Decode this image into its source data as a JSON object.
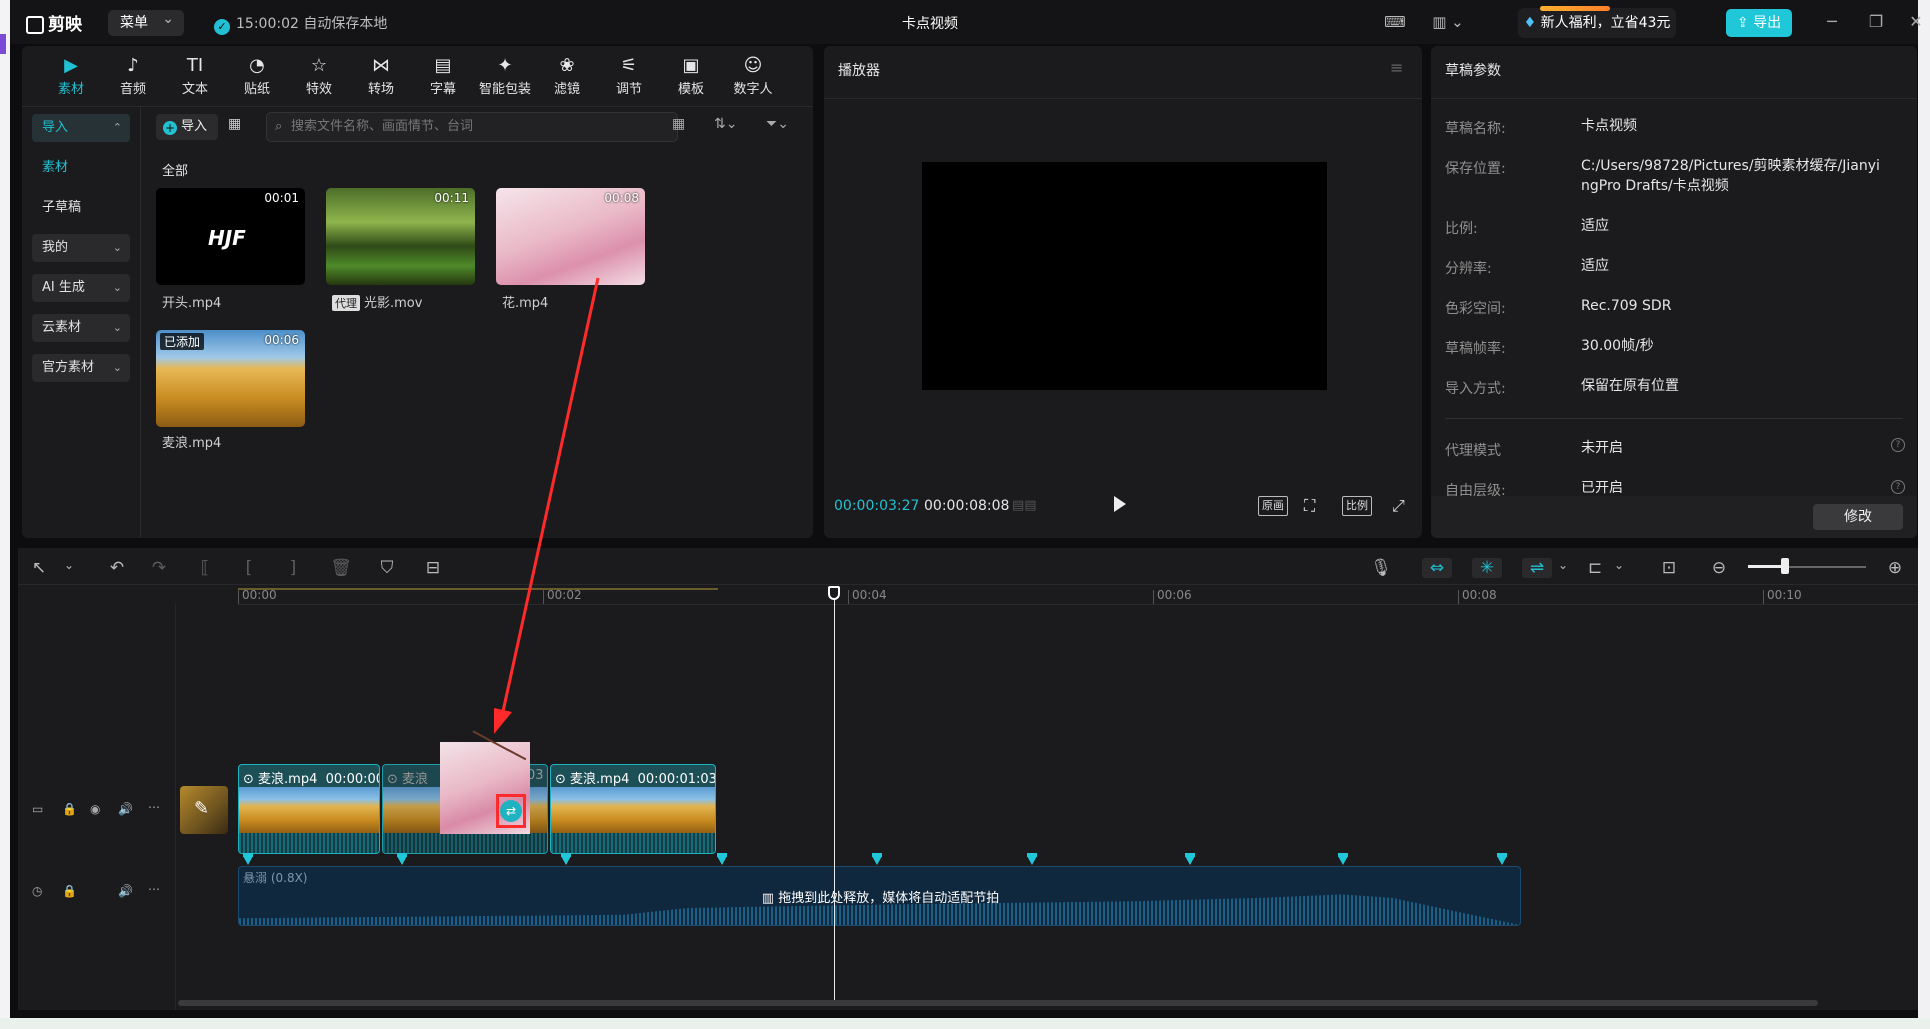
{
  "app": {
    "logo": "剪映",
    "menu_label": "菜单",
    "save_status": "15:00:02 自动保存本地",
    "title": "卡点视频",
    "promo": "新人福利，立省43元",
    "export_label": "导出"
  },
  "media_tabs": [
    {
      "label": "素材",
      "icon": "play-box-icon",
      "glyph": "▶"
    },
    {
      "label": "音频",
      "icon": "music-disc-icon",
      "glyph": "♪"
    },
    {
      "label": "文本",
      "icon": "text-icon",
      "glyph": "TI"
    },
    {
      "label": "贴纸",
      "icon": "sticker-icon",
      "glyph": "◔"
    },
    {
      "label": "特效",
      "icon": "effects-star-icon",
      "glyph": "☆"
    },
    {
      "label": "转场",
      "icon": "transition-icon",
      "glyph": "⋈"
    },
    {
      "label": "字幕",
      "icon": "subtitle-icon",
      "glyph": "▤"
    },
    {
      "label": "智能包装",
      "icon": "smart-pack-icon",
      "glyph": "✦"
    },
    {
      "label": "滤镜",
      "icon": "filter-icon",
      "glyph": "❀"
    },
    {
      "label": "调节",
      "icon": "adjust-icon",
      "glyph": "⚟"
    },
    {
      "label": "模板",
      "icon": "template-icon",
      "glyph": "▣"
    },
    {
      "label": "数字人",
      "icon": "digital-human-icon",
      "glyph": "☺"
    }
  ],
  "side_nav": {
    "import": "导入",
    "material": "素材",
    "sub_draft": "子草稿",
    "mine": "我的",
    "ai_gen": "AI 生成",
    "cloud": "云素材",
    "official": "官方素材"
  },
  "media": {
    "import_btn": "导入",
    "search_placeholder": "搜索文件名称、画面情节、台词",
    "section": "全部",
    "items": [
      {
        "name": "开头.mp4",
        "duration": "00:01",
        "overlay": "HJF"
      },
      {
        "name": "光影.mov",
        "duration": "00:11",
        "tag": "代理"
      },
      {
        "name": "花.mp4",
        "duration": "00:08"
      },
      {
        "name": "麦浪.mp4",
        "duration": "00:06",
        "badge": "已添加"
      }
    ]
  },
  "player": {
    "title": "播放器",
    "current": "00:00:03:27",
    "total": "00:00:08:08",
    "btn_original": "原画",
    "btn_ratio": "比例"
  },
  "params": {
    "title": "草稿参数",
    "rows": [
      {
        "k": "草稿名称:",
        "v": "卡点视频"
      },
      {
        "k": "保存位置:",
        "v": "C:/Users/98728/Pictures/剪映素材缓存/JianyingPro Drafts/卡点视频"
      },
      {
        "k": "比例:",
        "v": "适应"
      },
      {
        "k": "分辨率:",
        "v": "适应"
      },
      {
        "k": "色彩空间:",
        "v": "Rec.709 SDR"
      },
      {
        "k": "草稿帧率:",
        "v": "30.00帧/秒"
      },
      {
        "k": "导入方式:",
        "v": "保留在原有位置"
      },
      {
        "k": "代理模式",
        "v": "未开启"
      },
      {
        "k": "自由层级:",
        "v": "已开启"
      }
    ],
    "modify": "修改"
  },
  "timeline": {
    "ruler": [
      "00:00",
      "00:02",
      "00:04",
      "00:06",
      "00:08",
      "00:10"
    ],
    "clips": [
      {
        "name": "麦浪.mp4",
        "time": "00:00:00"
      },
      {
        "name": "麦浪",
        "time": "03"
      },
      {
        "name": "麦浪.mp4",
        "time": "00:00:01:03"
      }
    ],
    "audio_name": "悬溺 (0.8X)",
    "drop_hint": "拖拽到此处释放，媒体将自动适配节拍",
    "zoom_level": 0.3
  },
  "colors": {
    "accent": "#21c0d2",
    "annotation_red": "#ff2a2a"
  }
}
